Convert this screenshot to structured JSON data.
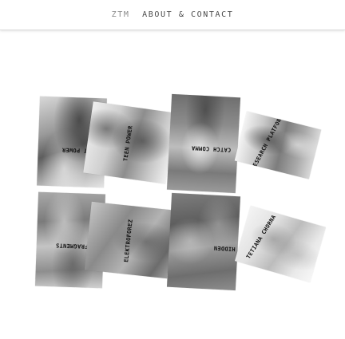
{
  "nav": {
    "logo": "ZTM",
    "about_contact": "ABOUT & CONTACT"
  },
  "projects": [
    {
      "label": "JUST POWER"
    },
    {
      "label": "TEEN POWER"
    },
    {
      "label": "CATCH COMMA"
    },
    {
      "label": "RESEARCH PLATFORM"
    },
    {
      "label": "FRAGMENTS"
    },
    {
      "label": "ELEKTROFOREZ"
    },
    {
      "label": "HIDDEN"
    },
    {
      "label": "TETIANA CHORNA"
    }
  ],
  "colors": {
    "background": "#ffffff",
    "nav_text": "#4a4a4a",
    "logo_text": "#8a8a8a",
    "label_text": "#111111"
  }
}
